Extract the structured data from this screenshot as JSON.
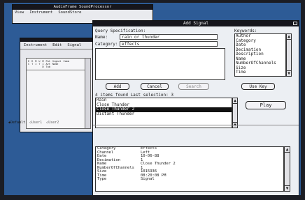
{
  "bg_window": {
    "title": "AudioFrame SoundProcessor",
    "menu": [
      "View",
      "Instrument",
      "SoundStore"
    ]
  },
  "instrument_window": {
    "menu": [
      "Instrument",
      "Edit",
      "Signal"
    ],
    "headers": [
      "E\nC",
      "R\nT",
      "M\nI",
      "U\nT",
      "M\nI\nD",
      "Pat\nAvt\nTab",
      "Signal\nName",
      "Comm"
    ],
    "radio_labels": [
      "Default",
      "User1",
      "User2"
    ]
  },
  "dialog": {
    "title": "Add Signal",
    "query_label": "Query Specification:",
    "name_label": "Name:",
    "name_value": "rain or thunder",
    "category_label": "Category:",
    "category_value": "effects",
    "keywords_label": "Keywords:",
    "keywords": [
      "Author",
      "Category",
      "Date",
      "Decimation",
      "Description",
      "Name",
      "NumberOfChannels",
      "Size",
      "Time"
    ],
    "buttons": {
      "add": "Add",
      "cancel": "Cancel",
      "search": "Search",
      "use_key": "Use Key",
      "play": "Play"
    },
    "found_text": "4 items found  Last selection: 3",
    "results": [
      "Rain",
      "Close Thunder",
      "Close Thunder 2",
      "Distant Thunder"
    ],
    "selected_index": 2,
    "details": [
      [
        "Category",
        "Effects"
      ],
      [
        "Channel",
        "Left"
      ],
      [
        "Date",
        "10-06-88"
      ],
      [
        "Decimation",
        "1"
      ],
      [
        "Name",
        "Close Thunder 2"
      ],
      [
        "NumberOfChannels",
        "1"
      ],
      [
        "Size",
        "1015936"
      ],
      [
        "Time",
        "08:20:08 PM"
      ],
      [
        "Type",
        "Signal"
      ]
    ]
  }
}
